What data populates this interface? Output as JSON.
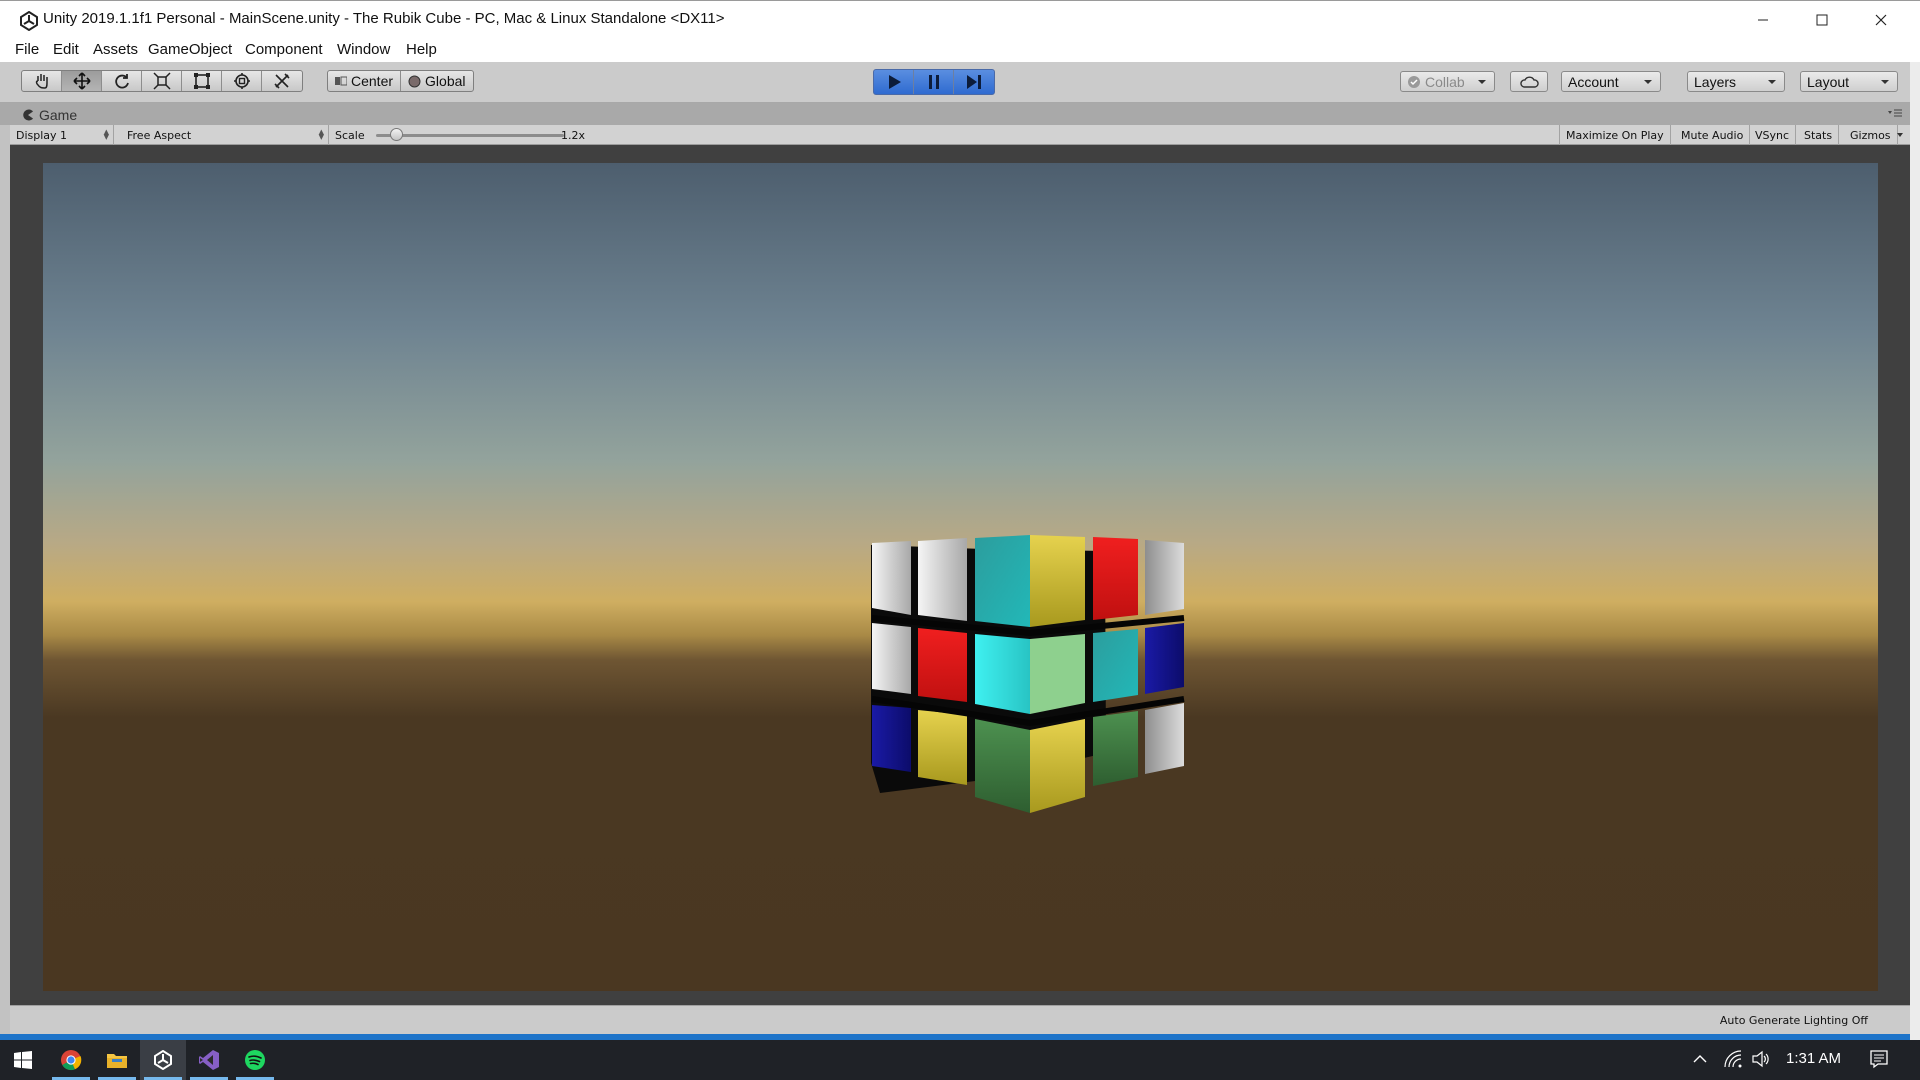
{
  "window": {
    "title": "Unity 2019.1.1f1 Personal - MainScene.unity - The Rubik Cube - PC, Mac & Linux Standalone <DX11>"
  },
  "menu": [
    "File",
    "Edit",
    "Assets",
    "GameObject",
    "Component",
    "Window",
    "Help"
  ],
  "toolbar": {
    "transform_tools": [
      "hand-tool",
      "move-tool",
      "rotate-tool",
      "scale-tool",
      "rect-tool",
      "transform-tool",
      "custom-tool"
    ],
    "active_tool": "move-tool",
    "pivot_mode": "Center",
    "pivot_rotation": "Global",
    "play_state": "playing",
    "collab_label": "Collab",
    "account_label": "Account",
    "layers_label": "Layers",
    "layout_label": "Layout"
  },
  "game_view": {
    "tab_label": "Game",
    "display": "Display 1",
    "aspect": "Free Aspect",
    "scale_label": "Scale",
    "scale_value_text": "1.2x",
    "scale_value": 1.2,
    "toggles": [
      "Maximize On Play",
      "Mute Audio",
      "VSync",
      "Stats",
      "Gizmos"
    ]
  },
  "cube_colors": {
    "white": "#e4e4e4",
    "red": "#e02020",
    "cyan": "#2ec6c6",
    "yellow": "#d7c84a",
    "blue": "#1a1aa8",
    "green": "#3c7a3c",
    "light_green": "#8ed08e"
  },
  "status": {
    "text": "Auto Generate Lighting Off"
  },
  "taskbar": {
    "apps": [
      "windows-start",
      "chrome",
      "file-explorer",
      "unity",
      "visual-studio",
      "spotify"
    ],
    "active_app": "unity",
    "clock": "1:31 AM"
  },
  "accent_color": "#1e74c9"
}
